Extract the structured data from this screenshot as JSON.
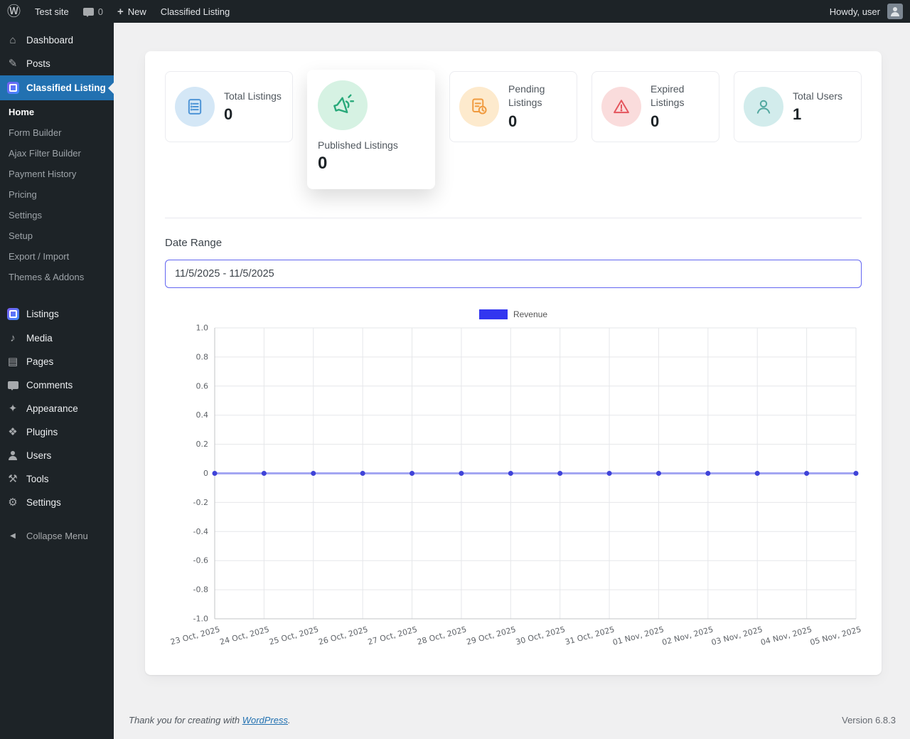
{
  "admin_bar": {
    "site_name": "Test site",
    "comments_count": "0",
    "new_label": "New",
    "current_page": "Classified Listing",
    "howdy_text": "Howdy, user"
  },
  "icons": {
    "wordpress": "Ⓦ",
    "plus": "+",
    "dashboard": "⌂",
    "posts": "✎",
    "media": "♪",
    "pages": "▤",
    "appearance": "✦",
    "plugins": "❖",
    "tools": "⚒",
    "settings": "⚙",
    "collapse": "◀"
  },
  "sidebar": {
    "menu": [
      {
        "label": "Dashboard"
      },
      {
        "label": "Posts"
      },
      {
        "label": "Classified Listing"
      },
      {
        "label": "Listings"
      },
      {
        "label": "Media"
      },
      {
        "label": "Pages"
      },
      {
        "label": "Comments"
      },
      {
        "label": "Appearance"
      },
      {
        "label": "Plugins"
      },
      {
        "label": "Users"
      },
      {
        "label": "Tools"
      },
      {
        "label": "Settings"
      },
      {
        "label": "Collapse Menu"
      }
    ],
    "submenu": [
      {
        "label": "Home"
      },
      {
        "label": "Form Builder"
      },
      {
        "label": "Ajax Filter Builder"
      },
      {
        "label": "Payment History"
      },
      {
        "label": "Pricing"
      },
      {
        "label": "Settings"
      },
      {
        "label": "Setup"
      },
      {
        "label": "Export / Import"
      },
      {
        "label": "Themes & Addons"
      }
    ]
  },
  "stats": [
    {
      "label": "Total Listings",
      "value": "0"
    },
    {
      "label": "Published Listings",
      "value": "0"
    },
    {
      "label": "Pending Listings",
      "value": "0"
    },
    {
      "label": "Expired Listings",
      "value": "0"
    },
    {
      "label": "Total Users",
      "value": "1"
    }
  ],
  "filters": {
    "date_range_label": "Date Range",
    "date_range_value": "11/5/2025 - 11/5/2025"
  },
  "chart_data": {
    "type": "line",
    "title": "",
    "x": [
      "23 Oct, 2025",
      "24 Oct, 2025",
      "25 Oct, 2025",
      "26 Oct, 2025",
      "27 Oct, 2025",
      "28 Oct, 2025",
      "29 Oct, 2025",
      "30 Oct, 2025",
      "31 Oct, 2025",
      "01 Nov, 2025",
      "02 Nov, 2025",
      "03 Nov, 2025",
      "04 Nov, 2025",
      "05 Nov, 2025"
    ],
    "series": [
      {
        "name": "Revenue",
        "values": [
          0,
          0,
          0,
          0,
          0,
          0,
          0,
          0,
          0,
          0,
          0,
          0,
          0,
          0
        ]
      }
    ],
    "ylim": [
      -1,
      1
    ],
    "y_ticks": [
      1,
      0.8,
      0.6,
      0.4,
      0.2,
      0,
      -0.2,
      -0.4,
      -0.6,
      -0.8,
      -1
    ],
    "grid": true,
    "legend_position": "top",
    "colors": {
      "line": "#a3a6f2",
      "point": "#3f43d8",
      "legend_swatch": "#3236f0",
      "grid": "#e6e7ea",
      "axis": "#c3c4c7",
      "tick_text": "#5f6368"
    }
  },
  "footer": {
    "thanks_prefix": "Thank you for creating with ",
    "link_text": "WordPress",
    "suffix": ".",
    "version": "Version 6.8.3"
  },
  "theme": {
    "admin_bar_bg": "#1d2327",
    "sidebar_bg": "#1d2327",
    "active_menu_bg": "#2271b1",
    "content_bg": "#f0f0f1",
    "date_input_border": "#6366f1",
    "stat_colors": {
      "total": {
        "bg": "#d4e7f6",
        "fg": "#4d94d6"
      },
      "published": {
        "bg": "#d6f2e3",
        "fg": "#28a97a"
      },
      "pending": {
        "bg": "#fdeacd",
        "fg": "#f09a3e"
      },
      "expired": {
        "bg": "#fadcdc",
        "fg": "#e4555d"
      },
      "users": {
        "bg": "#d2ecec",
        "fg": "#53a8a0"
      }
    }
  }
}
